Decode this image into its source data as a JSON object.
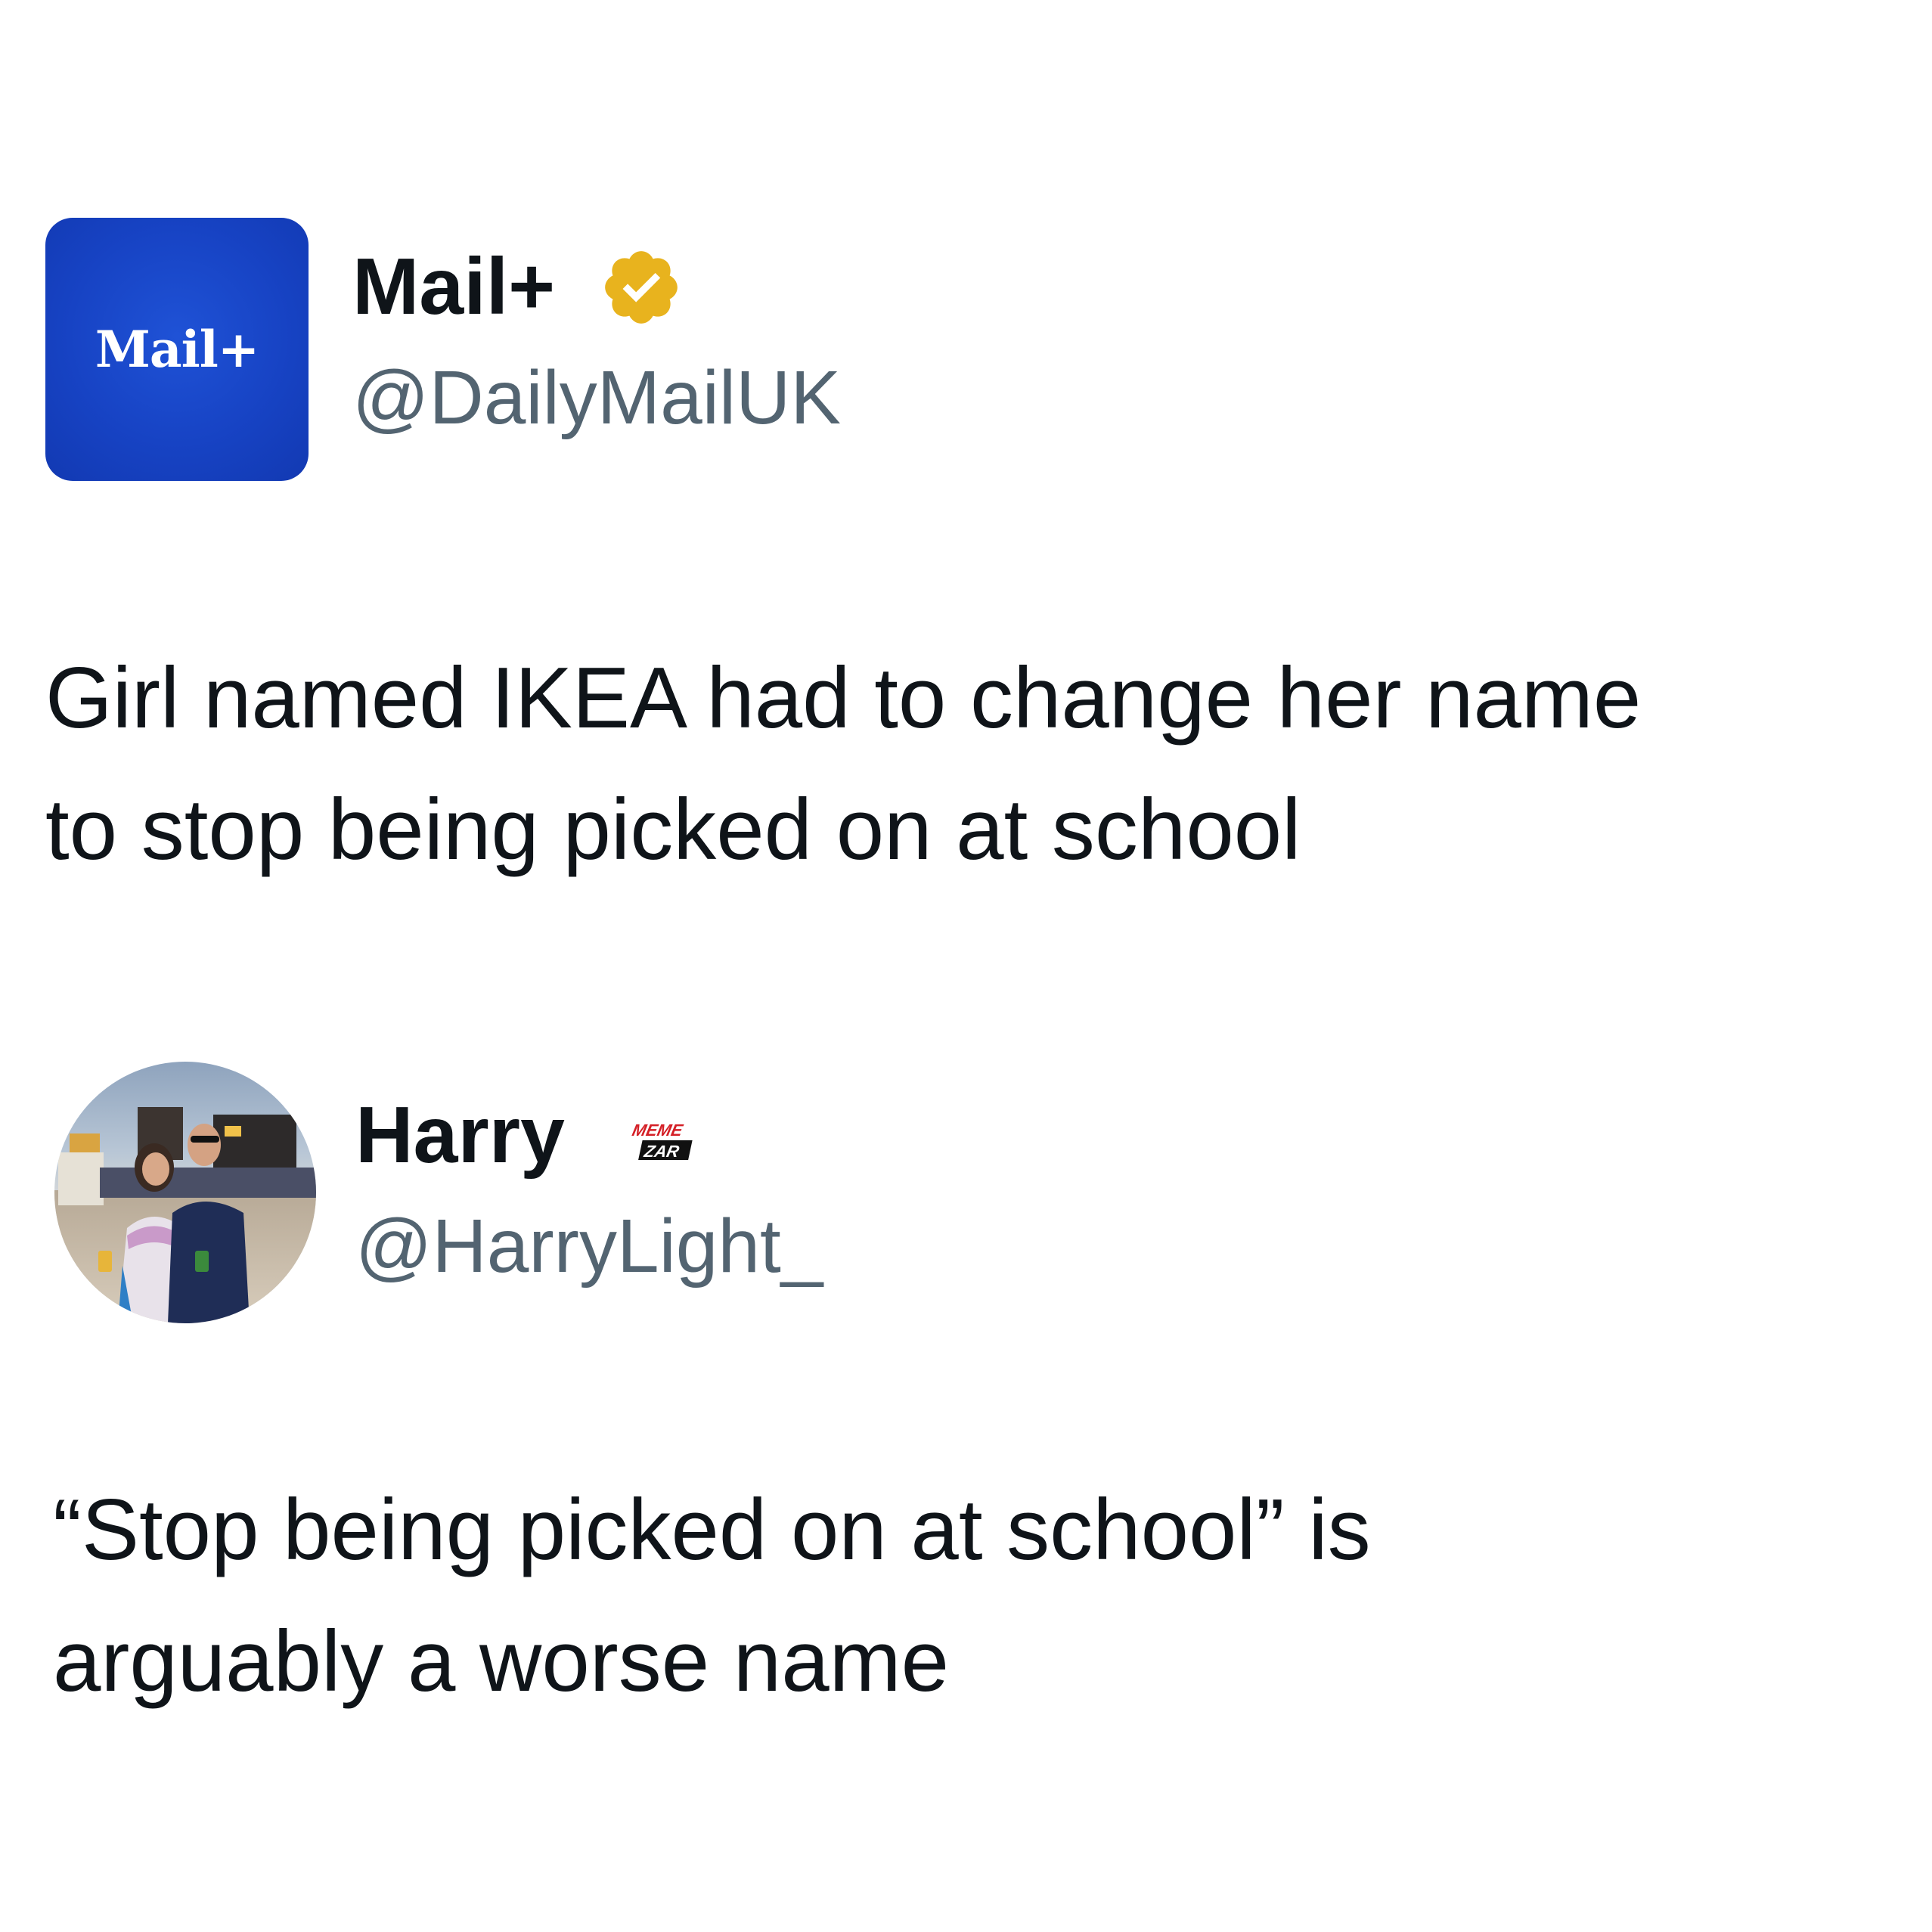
{
  "post1": {
    "avatar_text": "Mail+",
    "display_name": "Mail+",
    "handle": "@DailyMailUK",
    "verified_badge_icon": "verified-badge-icon",
    "text_line1": "Girl named IKEA had to change her name",
    "text_line2": "to stop being picked on at school"
  },
  "post2": {
    "display_name": "Harry",
    "handle": "@HarryLight_",
    "watermark_line1": "MEME",
    "watermark_line2": "ZAR",
    "text_line1": "“Stop being picked on at school” is",
    "text_line2": "arguably a worse name"
  },
  "colors": {
    "brand_blue": "#1743c4",
    "verified_gold": "#e8b31e",
    "handle_gray": "#536471",
    "text_black": "#0f1419",
    "watermark_red": "#d41f26"
  }
}
